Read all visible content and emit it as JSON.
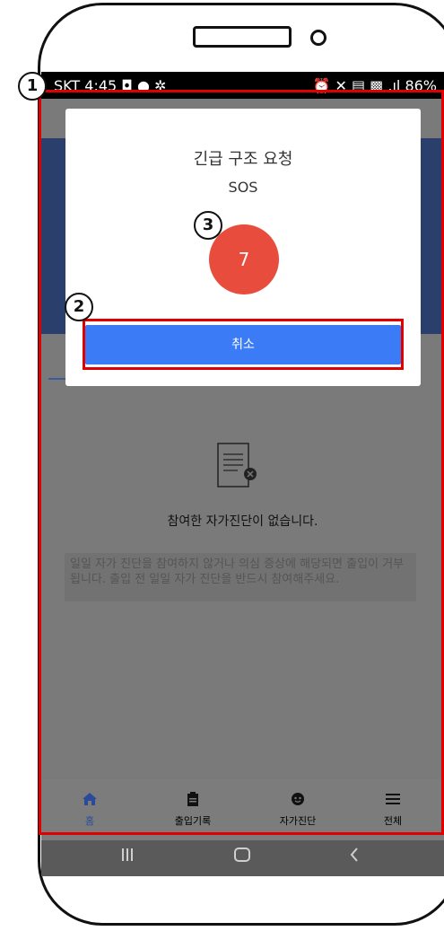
{
  "statusbar": {
    "carrier_time": "SKT 4:45",
    "left_icons": "◘ ● ✲",
    "right_info": "⏰ ✕ ▤ ▩ .ıl 86%"
  },
  "dialog": {
    "title": "긴급 구조 요청",
    "subtitle": "SOS",
    "countdown": "7",
    "cancel_label": "취소"
  },
  "empty_state": {
    "title": "참여한 자가진단이 없습니다.",
    "description": "일일 자가 진단을 참여하지 않거나 의심 증상에 해당되면 출입이 거부됩니다. 출입 전 일일 자가 진단을 반드시 참여해주세요."
  },
  "tabbar": [
    {
      "label": "홈",
      "icon": "home-icon"
    },
    {
      "label": "출입기록",
      "icon": "clipboard-icon"
    },
    {
      "label": "자가진단",
      "icon": "face-icon"
    },
    {
      "label": "전체",
      "icon": "menu-icon"
    }
  ],
  "android_nav": [
    "recent-apps",
    "home",
    "back"
  ],
  "annotations": [
    "1",
    "2",
    "3"
  ],
  "colors": {
    "accent_blue": "#3b7cf6",
    "countdown_red": "#e74c3c",
    "highlight_red": "#e00000",
    "active_tab": "#2a4a9a"
  }
}
